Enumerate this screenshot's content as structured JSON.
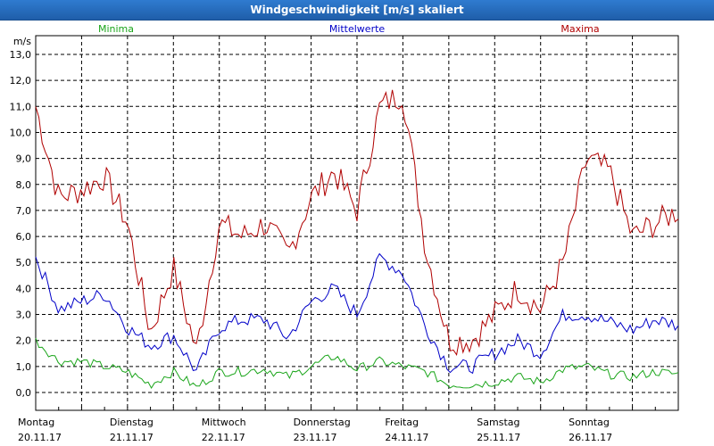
{
  "window": {
    "title": "Windgeschwindigkeit [m/s] skaliert"
  },
  "colors": {
    "minima": "#1aa51a",
    "mittelwerte": "#0000c8",
    "maxima": "#b00000",
    "grid": "#000000",
    "titlebar": "#2f7bd0"
  },
  "chart_data": {
    "type": "line",
    "title": "Windgeschwindigkeit [m/s] skaliert",
    "ylabel": "m/s",
    "ylim": [
      0,
      13
    ],
    "yticks": [
      "0,0",
      "1,0",
      "2,0",
      "3,0",
      "4,0",
      "5,0",
      "6,0",
      "7,0",
      "8,0",
      "9,0",
      "10,0",
      "11,0",
      "12,0",
      "13,0"
    ],
    "grid": true,
    "legend": {
      "placement": "top",
      "entries": [
        "Minima",
        "Mittelwerte",
        "Maxima"
      ]
    },
    "days": [
      {
        "weekday": "Montag",
        "date": "20.11.17"
      },
      {
        "weekday": "Dienstag",
        "date": "21.11.17"
      },
      {
        "weekday": "Mittwoch",
        "date": "22.11.17"
      },
      {
        "weekday": "Donnerstag",
        "date": "23.11.17"
      },
      {
        "weekday": "Freitag",
        "date": "24.11.17"
      },
      {
        "weekday": "Samstag",
        "date": "25.11.17"
      },
      {
        "weekday": "Sonntag",
        "date": "26.11.17"
      }
    ],
    "x": [
      0.0,
      0.25,
      0.5,
      0.75,
      1.0,
      1.25,
      1.5,
      1.75,
      2.0,
      2.25,
      2.5,
      2.75,
      3.0,
      3.25,
      3.5,
      3.75,
      4.0,
      4.25,
      4.5,
      4.75,
      5.0,
      5.25,
      5.5,
      5.75,
      6.0,
      6.25,
      6.5,
      6.75,
      7.0
    ],
    "series": [
      {
        "name": "Maxima",
        "values": [
          11.0,
          7.5,
          7.8,
          8.3,
          6.5,
          2.3,
          4.8,
          1.6,
          6.5,
          6.0,
          6.5,
          5.3,
          7.5,
          8.5,
          7.0,
          11.0,
          11.5,
          5.5,
          2.0,
          2.0,
          3.0,
          4.0,
          3.2,
          5.0,
          9.0,
          8.5,
          6.0,
          6.5,
          7.0
        ]
      },
      {
        "name": "Mittelwerte",
        "values": [
          5.2,
          3.2,
          3.5,
          3.8,
          2.5,
          1.8,
          2.2,
          0.8,
          2.5,
          2.8,
          2.8,
          2.1,
          3.5,
          4.0,
          3.0,
          5.2,
          4.6,
          2.5,
          1.0,
          1.0,
          1.5,
          2.0,
          1.5,
          3.0,
          3.0,
          2.7,
          2.4,
          2.8,
          2.6
        ]
      },
      {
        "name": "Minima",
        "values": [
          2.0,
          1.2,
          1.2,
          1.0,
          0.8,
          0.3,
          0.8,
          0.2,
          0.8,
          0.8,
          0.9,
          0.6,
          1.0,
          1.4,
          0.9,
          1.2,
          1.0,
          0.8,
          0.3,
          0.3,
          0.4,
          0.6,
          0.4,
          0.9,
          1.0,
          0.7,
          0.6,
          0.8,
          0.7
        ]
      }
    ]
  }
}
